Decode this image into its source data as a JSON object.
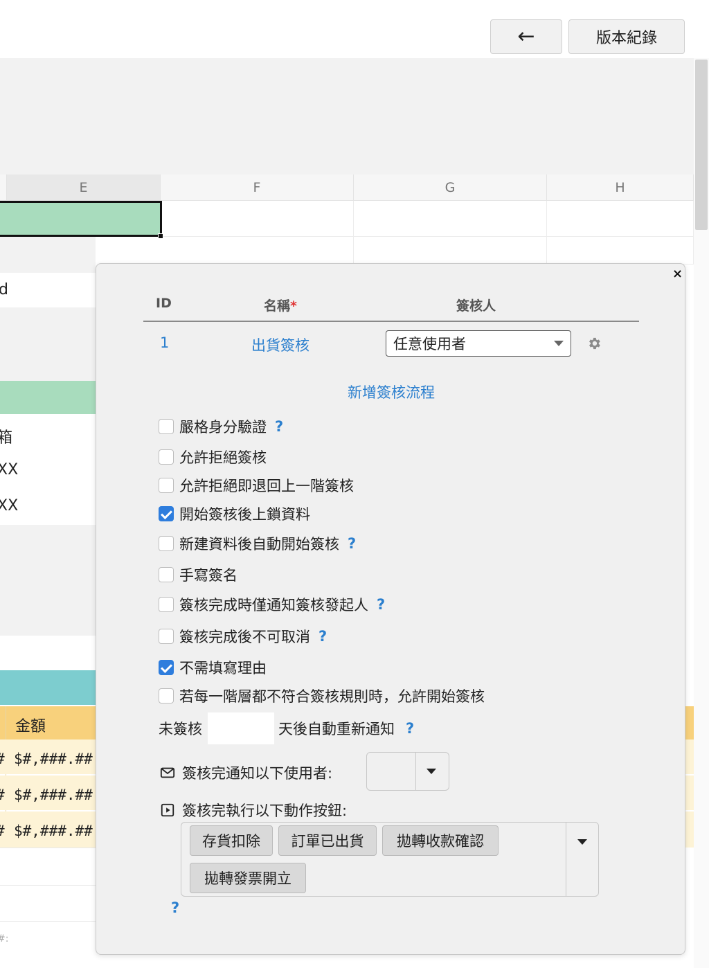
{
  "toolbar": {
    "back_icon": "arrow-left-icon",
    "back_symbol": "←",
    "version_label": "版本紀錄"
  },
  "sheet": {
    "columns": [
      "E",
      "F",
      "G",
      "H"
    ],
    "left_fragments": [
      "d",
      "箱",
      "XX",
      "XX"
    ],
    "amount_header": "金額",
    "amount_format": "$#,###.##",
    "row_prefix": "#",
    "footer_fragment": "#:",
    "colors": {
      "selected": "#a8dcbd",
      "green_row": "#a8dcbd",
      "teal_row": "#7dcdcf",
      "yellow_header": "#f8d17c",
      "yellow_row": "#fdf3d6"
    }
  },
  "dialog": {
    "close_symbol": "×",
    "headers": {
      "id": "ID",
      "name": "名稱",
      "required_mark": "*",
      "approver": "簽核人"
    },
    "row": {
      "id": "1",
      "name": "出貨簽核",
      "approver": "任意使用者"
    },
    "add_flow_label": "新增簽核流程",
    "options": [
      {
        "label": "嚴格身分驗證",
        "checked": false,
        "help": true
      },
      {
        "label": "允許拒絕簽核",
        "checked": false,
        "help": false
      },
      {
        "label": "允許拒絕即退回上一階簽核",
        "checked": false,
        "help": false
      },
      {
        "label": "開始簽核後上鎖資料",
        "checked": true,
        "help": false
      },
      {
        "label": "新建資料後自動開始簽核",
        "checked": false,
        "help": true
      },
      {
        "label": "手寫簽名",
        "checked": false,
        "help": false
      },
      {
        "label": "簽核完成時僅通知簽核發起人",
        "checked": false,
        "help": true
      },
      {
        "label": "簽核完成後不可取消",
        "checked": false,
        "help": true
      },
      {
        "label": "不需填寫理由",
        "checked": true,
        "help": false
      },
      {
        "label": "若每一階層都不符合簽核規則時，允許開始簽核",
        "checked": false,
        "help": false
      }
    ],
    "help_symbol": "?",
    "days": {
      "prefix": "未簽核",
      "value": "",
      "suffix": "天後自動重新通知"
    },
    "notify_label": "簽核完通知以下使用者:",
    "action_label": "簽核完執行以下動作按鈕:",
    "action_tags": [
      "存貨扣除",
      "訂單已出貨",
      "拋轉收款確認",
      "拋轉發票開立"
    ],
    "accent_color": "#2b7fce",
    "checkbox_color": "#2e7ddd"
  }
}
